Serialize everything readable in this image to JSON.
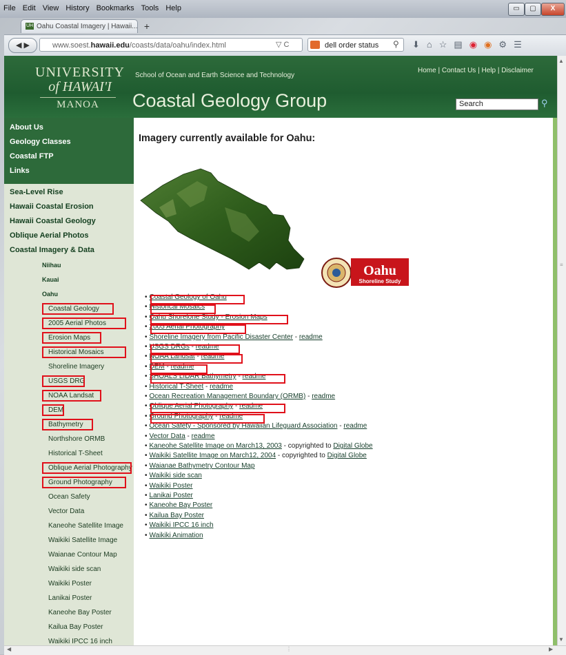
{
  "browser": {
    "menu": [
      "File",
      "Edit",
      "View",
      "History",
      "Bookmarks",
      "Tools",
      "Help"
    ],
    "tab_title": "Oahu Coastal Imagery | Hawaii...",
    "tab_favicon": "UH",
    "url_prefix": "www.soest.",
    "url_domain": "hawaii.edu",
    "url_path": "/coasts/data/oahu/index.html",
    "search_text": "dell order status",
    "window_buttons": [
      "▭",
      "▢",
      "X"
    ]
  },
  "site": {
    "logo_line1": "UNIVERSITY",
    "logo_line2": "of HAWAI'I",
    "logo_line3": "MANOA",
    "school": "School of Ocean and Earth Science and Technology",
    "toplinks": [
      "Home",
      "Contact Us",
      "Help",
      "Disclaimer"
    ],
    "group_title": "Coastal Geology Group",
    "search_placeholder": "Search"
  },
  "sidebar": {
    "top": [
      "About Us",
      "Geology Classes",
      "Coastal FTP",
      "Links"
    ],
    "main": [
      "Sea-Level Rise",
      "Hawaii Coastal Erosion",
      "Hawaii Coastal Geology",
      "Oblique Aerial Photos",
      "Coastal Imagery & Data"
    ],
    "regions": [
      "Niihau",
      "Kauai",
      "Oahu"
    ],
    "sub": [
      "Coastal Geology",
      "2005 Aerial Photos",
      "Erosion Maps",
      "Historical Mosaics",
      "Shoreline Imagery",
      "USGS DRG",
      "NOAA Landsat",
      "DEM",
      "Bathymetry",
      "Northshore ORMB",
      "Historical T-Sheet",
      "Oblique Aerial Photography",
      "Ground Photography",
      "Ocean Safety",
      "Vector Data",
      "Kaneohe Satellite Image",
      "Waikiki Satellite Image",
      "Waianae Contour Map",
      "Waikiki side scan",
      "Waikiki Poster",
      "Lanikai Poster",
      "Kaneohe Bay Poster",
      "Kailua Bay Poster",
      "Waikiki IPCC 16 inch"
    ]
  },
  "content": {
    "title": "Imagery currently available for Oahu:",
    "badge_title": "Oahu",
    "badge_sub": "Shoreline Study",
    "links": [
      {
        "text": "Coastal Geology of Oahu"
      },
      {
        "text": "Historical Mosaics"
      },
      {
        "text": "Oahu Shorelone Study - Erosion Maps"
      },
      {
        "text": "2005 Aerial Photography"
      },
      {
        "text": "Shoreline Imagery from Pacific Disaster Center",
        "sep": " - ",
        "extra": "readme"
      },
      {
        "text": "USGS DRGs",
        "sep": " - ",
        "extra": "readme"
      },
      {
        "text": "NOAA Landsat",
        "sep": " - ",
        "extra": "readme"
      },
      {
        "text": "DEM",
        "sep": " - ",
        "extra": "readme"
      },
      {
        "text": "SHOALS LIDAR Bathymetry",
        "sep": " - ",
        "extra": "readme"
      },
      {
        "text": "Historical T-Sheet",
        "sep": " - ",
        "extra": "readme"
      },
      {
        "text": "Ocean Recreation Management Boundary (ORMB)",
        "sep": " - ",
        "extra": "readme"
      },
      {
        "text": "Oblique Aerial Photography",
        "sep": " - ",
        "extra": "readme"
      },
      {
        "text": "Ground Photography",
        "sep": " - ",
        "extra": "readme"
      },
      {
        "text": "Ocean Safety - Sponsored by Hawaiian Lifeguard Association",
        "sep": " - ",
        "extra": "readme"
      },
      {
        "text": "Vector Data",
        "sep": " - ",
        "extra": "readme"
      },
      {
        "text": "Kaneohe Satellite Image on March13, 2003",
        "sep": " - copyrighted to ",
        "extra": "Digital Globe"
      },
      {
        "text": "Waikiki Satellite Image on March12, 2004",
        "sep": " - copyrighted to ",
        "extra": "Digital Globe"
      },
      {
        "text": "Waianae Bathymetry Contour Map"
      },
      {
        "text": "Waikiki side scan"
      },
      {
        "text": "Waikiki Poster"
      },
      {
        "text": "Lanikai Poster"
      },
      {
        "text": "Kaneohe Bay Poster"
      },
      {
        "text": "Kailua Bay Poster"
      },
      {
        "text": "Waikiki IPCC 16 inch"
      },
      {
        "text": "Waikiki Animation"
      }
    ]
  },
  "colors": {
    "header_green": "#2d6a3a",
    "sidebar_light": "#dfe6d6",
    "highlight_red": "#e0101a",
    "link_green": "#153d2a"
  }
}
